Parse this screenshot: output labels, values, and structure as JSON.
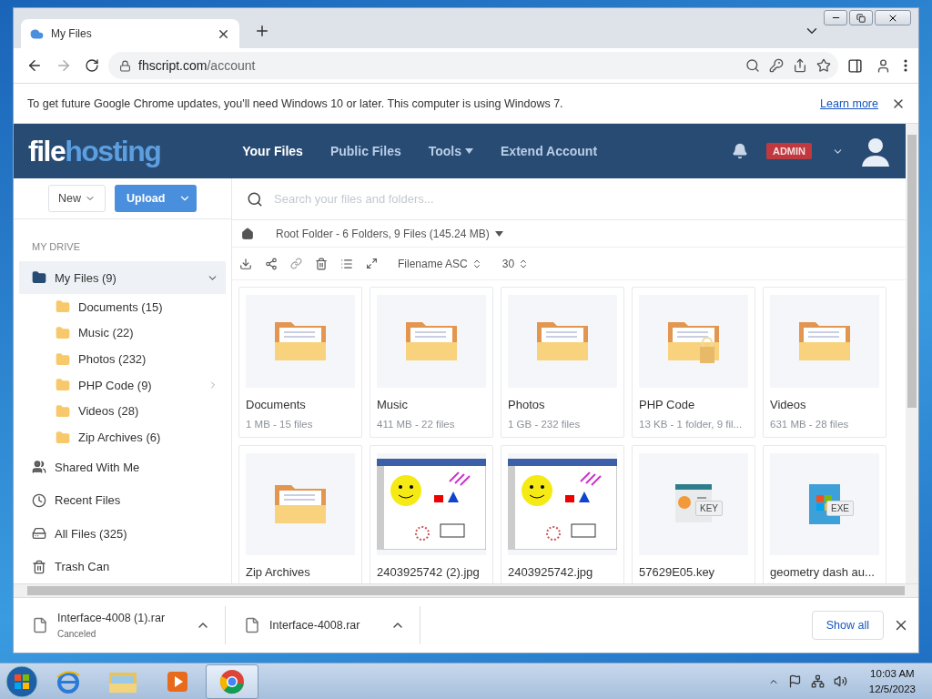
{
  "browser": {
    "tab": {
      "title": "My Files"
    },
    "address": {
      "host": "fhscript.com",
      "path": "/account"
    },
    "infobar": {
      "message": "To get future Google Chrome updates, you'll need Windows 10 or later. This computer is using Windows 7.",
      "link": "Learn more"
    }
  },
  "site": {
    "logo": {
      "first": "file",
      "second": "hosting"
    },
    "nav": [
      {
        "label": "Your Files",
        "selected": true,
        "has_menu": false
      },
      {
        "label": "Public Files",
        "selected": false,
        "has_menu": false
      },
      {
        "label": "Tools",
        "selected": false,
        "has_menu": true
      },
      {
        "label": "Extend Account",
        "selected": false,
        "has_menu": false
      }
    ],
    "role_badge": "ADMIN"
  },
  "sidebar": {
    "new_button": "New",
    "upload_button": "Upload",
    "section": "MY DRIVE",
    "items": [
      {
        "label": "My Files (9)",
        "kind": "folder",
        "selected": true,
        "expanded": true,
        "children": [
          {
            "label": "Documents (15)",
            "expandable": false
          },
          {
            "label": "Music (22)",
            "expandable": false
          },
          {
            "label": "Photos (232)",
            "expandable": false
          },
          {
            "label": "PHP Code (9)",
            "expandable": true
          },
          {
            "label": "Videos (28)",
            "expandable": false
          },
          {
            "label": "Zip Archives (6)",
            "expandable": false
          }
        ]
      },
      {
        "label": "Shared With Me",
        "kind": "shared",
        "selected": false
      },
      {
        "label": "Recent Files",
        "kind": "recent",
        "selected": false
      },
      {
        "label": "All Files (325)",
        "kind": "all",
        "selected": false
      },
      {
        "label": "Trash Can",
        "kind": "trash",
        "selected": false
      }
    ]
  },
  "main": {
    "search": {
      "placeholder": "Search your files and folders..."
    },
    "breadcrumb": "Root Folder - 6 Folders, 9 Files (145.24 MB)",
    "sort": "Filename ASC",
    "per_page": "30",
    "items": [
      {
        "name": "Documents",
        "meta": "1 MB - 15 files",
        "kind": "folder"
      },
      {
        "name": "Music",
        "meta": "411 MB - 22 files",
        "kind": "folder"
      },
      {
        "name": "Photos",
        "meta": "1 GB - 232 files",
        "kind": "folder"
      },
      {
        "name": "PHP Code",
        "meta": "13 KB - 1 folder, 9 fil...",
        "kind": "locked_folder"
      },
      {
        "name": "Videos",
        "meta": "631 MB - 28 files",
        "kind": "folder"
      },
      {
        "name": "Zip Archives",
        "kind": "folder"
      },
      {
        "name": "2403925742 (2).jpg",
        "kind": "image"
      },
      {
        "name": "2403925742.jpg",
        "kind": "image"
      },
      {
        "name": "57629E05.key",
        "kind": "key",
        "badge": "KEY"
      },
      {
        "name": "geometry dash au...",
        "kind": "exe",
        "badge": "EXE"
      }
    ]
  },
  "downloads": {
    "items": [
      {
        "name": "Interface-4008 (1).rar",
        "status": "Canceled"
      },
      {
        "name": "Interface-4008.rar"
      }
    ],
    "show_all": "Show all"
  },
  "taskbar": {
    "apps": [
      {
        "kind": "ie",
        "selected": false
      },
      {
        "kind": "explorer",
        "selected": false
      },
      {
        "kind": "media",
        "selected": false
      },
      {
        "kind": "chrome",
        "selected": true
      }
    ],
    "time": "10:03 AM",
    "date": "12/5/2023"
  }
}
